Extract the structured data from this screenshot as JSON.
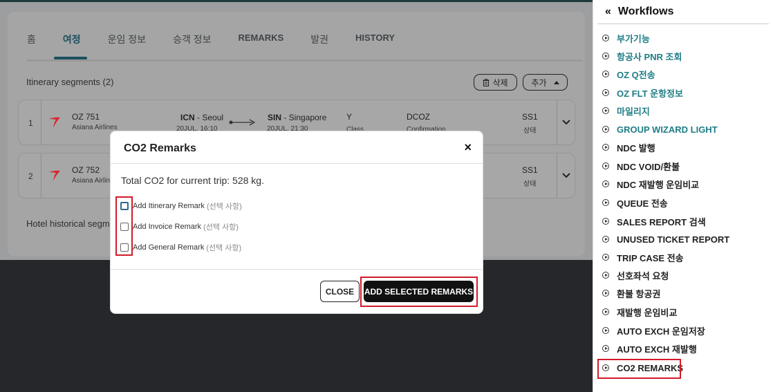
{
  "tabs": [
    "홈",
    "여정",
    "운임 정보",
    "승객 정보",
    "REMARKS",
    "발권",
    "HISTORY"
  ],
  "segments_title": "Itinerary segments (2)",
  "buttons": {
    "delete": "삭제",
    "add": "추가"
  },
  "segments": [
    {
      "num": "1",
      "flight": "OZ 751",
      "airline": "Asiana Airlines",
      "origin_code": "ICN",
      "origin_city": " - Seoul",
      "dep": "20JUL, 16:10",
      "dest_code": "SIN",
      "dest_city": " - Singapore",
      "arr": "20JUL, 21:30",
      "class": "Y",
      "class_label": "Class",
      "conf": "DCOZ",
      "conf_label": "Confirmation",
      "status": "SS1",
      "status_label": "상태"
    },
    {
      "num": "2",
      "flight": "OZ 752",
      "airline": "Asiana Airlin",
      "status": "SS1",
      "status_label": "상태"
    }
  ],
  "hotel_text": "Hotel historical segme",
  "modal": {
    "title": "CO2 Remarks",
    "total": "Total CO2 for current trip: 528 kg.",
    "options": [
      {
        "label": "Add Itinerary Remark",
        "optional": "(선택 사항)"
      },
      {
        "label": "Add Invoice Remark",
        "optional": "(선택 사항)"
      },
      {
        "label": "Add General Remark",
        "optional": "(선택 사항)"
      }
    ],
    "close_btn": "CLOSE",
    "add_btn": "ADD SELECTED REMARKS",
    "close_x": "×"
  },
  "workflows": {
    "collapse": "«",
    "title": "Workflows",
    "items": [
      "부가기능",
      "항공사 PNR 조회",
      "OZ Q전송",
      "OZ FLT 운항정보",
      "마일리지",
      "GROUP WIZARD LIGHT",
      "NDC 발행",
      "NDC VOID/환불",
      "NDC 재발행 운임비교",
      "QUEUE 전송",
      "SALES REPORT 검색",
      "UNUSED TICKET REPORT",
      "TRIP CASE 전송",
      "선호좌석 요청",
      "환불 항공권",
      "재발행 운임비교",
      "AUTO EXCH 운임저장",
      "AUTO EXCH 재발행",
      "CO2 REMARKS"
    ]
  }
}
